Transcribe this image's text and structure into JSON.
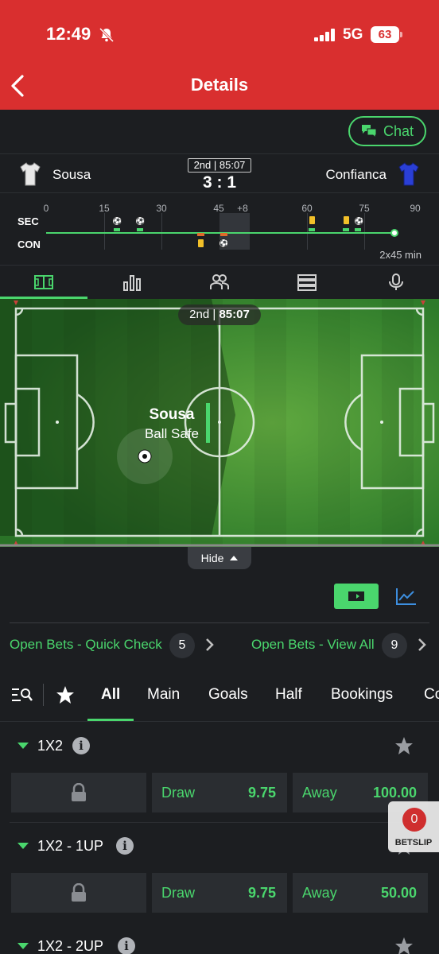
{
  "status": {
    "time": "12:49",
    "network": "5G",
    "battery": "63"
  },
  "header": {
    "title": "Details"
  },
  "chat": {
    "label": "Chat"
  },
  "match": {
    "home": "Sousa",
    "away": "Confianca",
    "period": "2nd | 85:07",
    "score": "3 : 1",
    "period_half": "2nd",
    "clock": "85:07"
  },
  "timeline": {
    "ticks": [
      "0",
      "15",
      "30",
      "45",
      "+8",
      "60",
      "75",
      "90"
    ],
    "home_abbr": "SEC",
    "away_abbr": "CON",
    "duration": "2x45 min"
  },
  "pitch": {
    "team_on_ball": "Sousa",
    "ball_state": "Ball Safe",
    "hide_label": "Hide"
  },
  "open_bets": {
    "quick_label": "Open Bets - Quick Check",
    "quick_count": "5",
    "all_label": "Open Bets - View All",
    "all_count": "9"
  },
  "market_filters": [
    "All",
    "Main",
    "Goals",
    "Half",
    "Bookings",
    "Co"
  ],
  "markets": [
    {
      "name": "1X2",
      "draw_label": "Draw",
      "draw_odds": "9.75",
      "away_label": "Away",
      "away_odds": "100.00"
    },
    {
      "name": "1X2 - 1UP",
      "draw_label": "Draw",
      "draw_odds": "9.75",
      "away_label": "Away",
      "away_odds": "50.00"
    },
    {
      "name": "1X2 - 2UP"
    }
  ],
  "betslip": {
    "count": "0",
    "label": "BETSLIP"
  },
  "colors": {
    "brand_red": "#d92f2f",
    "accent_green": "#4ad66d",
    "background": "#1c1e21"
  }
}
